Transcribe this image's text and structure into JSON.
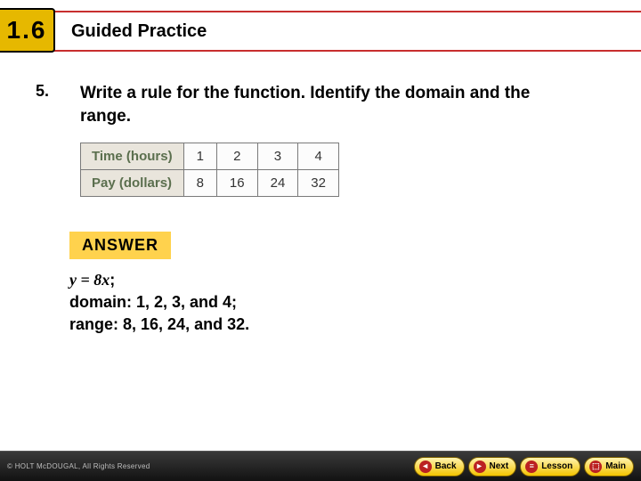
{
  "header": {
    "section_number": "1.6",
    "title": "Guided Practice"
  },
  "question": {
    "number": "5.",
    "prompt": "Write a rule for the function. Identify the domain and the range."
  },
  "table": {
    "row1_label": "Time (hours)",
    "row2_label": "Pay (dollars)",
    "cols": {
      "c0": {
        "time": "1",
        "pay": "8"
      },
      "c1": {
        "time": "2",
        "pay": "16"
      },
      "c2": {
        "time": "3",
        "pay": "24"
      },
      "c3": {
        "time": "4",
        "pay": "32"
      }
    }
  },
  "answer": {
    "label": "ANSWER",
    "rule": "y = 8x",
    "domain_line": "domain: 1, 2, 3, and 4;",
    "range_line": "range: 8, 16, 24, and 32."
  },
  "footer": {
    "copyright": "© HOLT McDOUGAL, All Rights Reserved",
    "back": "Back",
    "next": "Next",
    "lesson": "Lesson",
    "main": "Main"
  }
}
